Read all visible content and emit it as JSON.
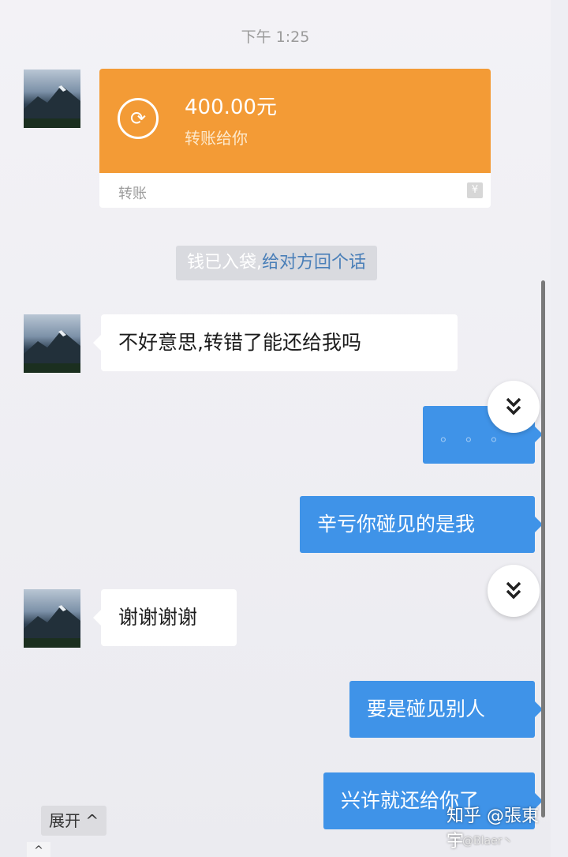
{
  "header": {
    "time": "下午 1:25"
  },
  "transfer": {
    "amount": "400.00元",
    "desc": "转账给你",
    "footer": "转账",
    "color": "#f39b36"
  },
  "system_notice": {
    "part1": "钱已入袋,",
    "part2": "给对方回个话"
  },
  "messages": [
    {
      "side": "left",
      "text": "不好意思,转错了能还给我吗"
    },
    {
      "side": "right",
      "text": "。。。"
    },
    {
      "side": "right",
      "text": "辛亏你碰见的是我"
    },
    {
      "side": "left",
      "text": "谢谢谢谢"
    },
    {
      "side": "right",
      "text": "要是碰见别人"
    },
    {
      "side": "right",
      "text": "兴许就还给你了"
    }
  ],
  "controls": {
    "expand_label": "展开 ^",
    "up_arrow": "^"
  },
  "watermark": {
    "line1": "知乎 @張東宇",
    "line2": "@Blaer丶"
  },
  "colors": {
    "bubble_right": "#3f93e8",
    "bubble_left": "#ffffff",
    "link": "#4a7fb8"
  },
  "icons": [
    "avatar-image",
    "transfer-coin-icon",
    "chevron-double-down-icon",
    "chevron-up-icon"
  ]
}
